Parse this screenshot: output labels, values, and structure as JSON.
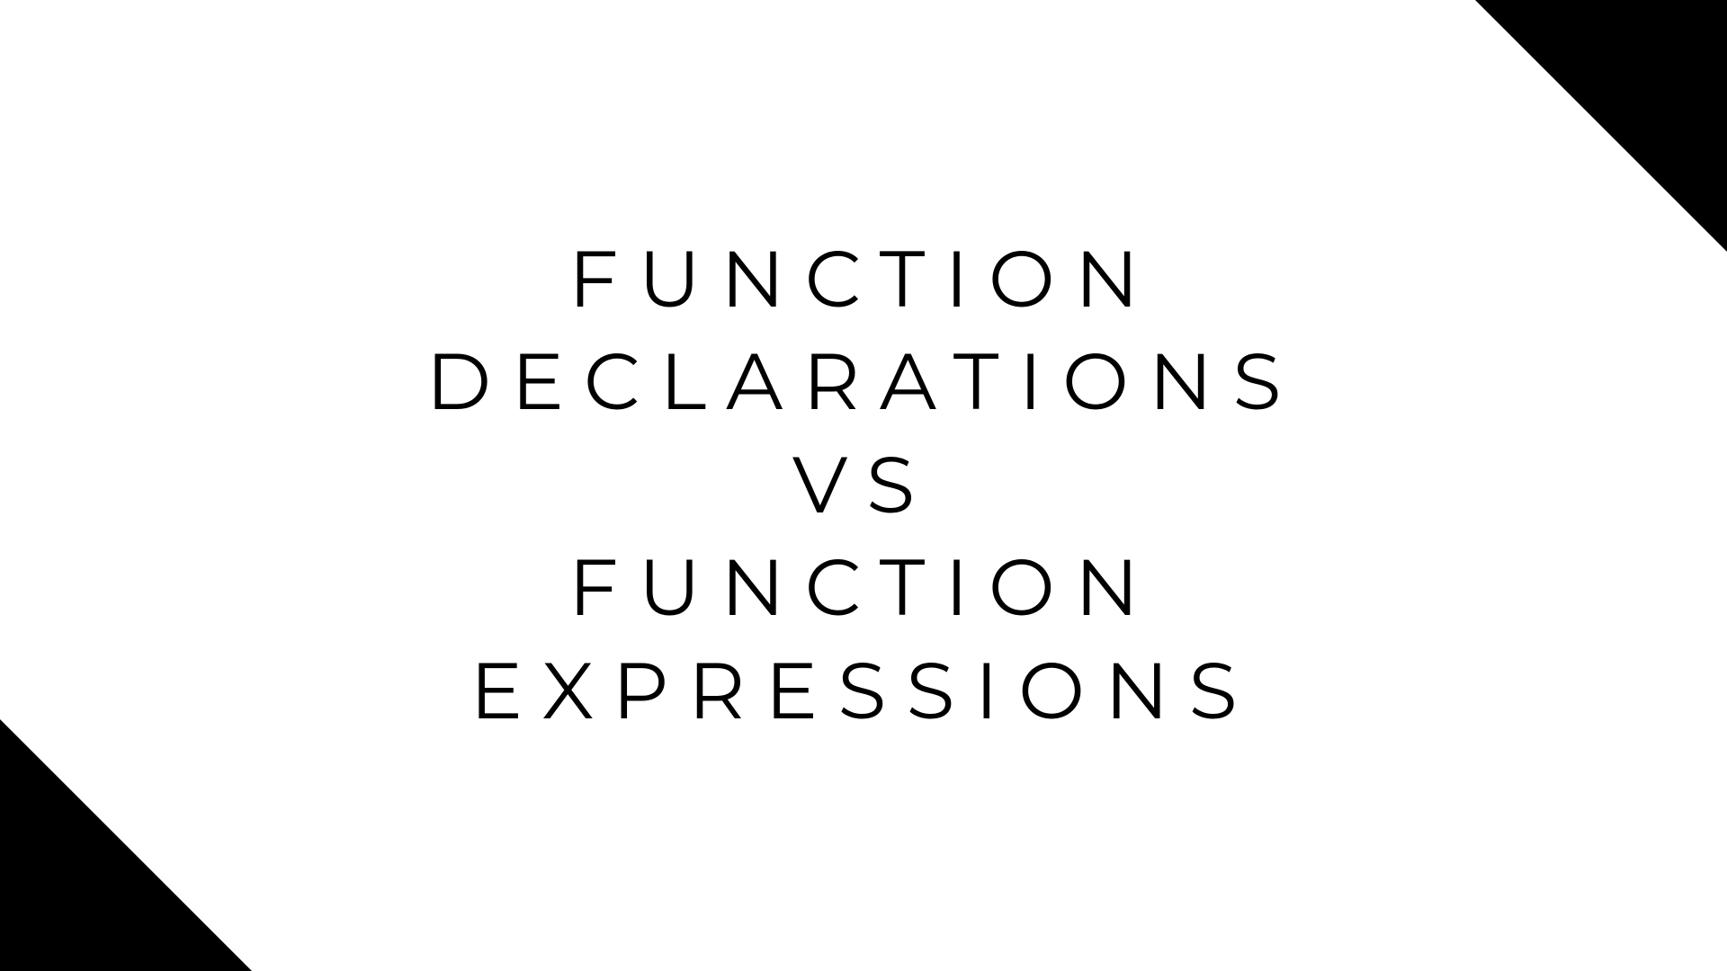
{
  "title": {
    "line1": "FUNCTION",
    "line2": "DECLARATIONS",
    "line3": "VS",
    "line4": "FUNCTION",
    "line5": "EXPRESSIONS"
  }
}
